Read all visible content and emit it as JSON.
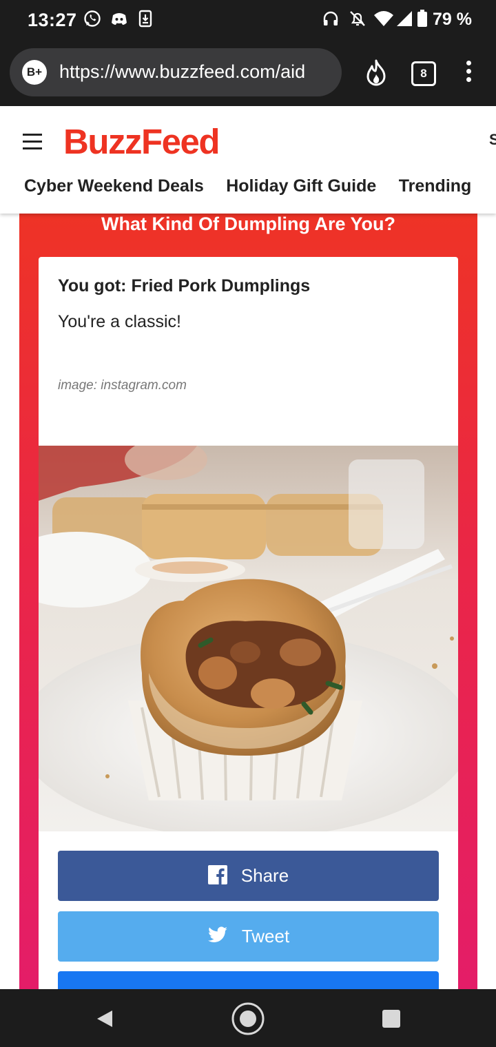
{
  "status_bar": {
    "time": "13:27",
    "battery": "79 %",
    "icons": [
      "whatsapp-icon",
      "discord-icon",
      "download-icon",
      "headphones-icon",
      "bell-off-icon",
      "wifi-icon",
      "signal-icon",
      "battery-icon"
    ]
  },
  "browser": {
    "site_badge": "B+",
    "url": "https://www.buzzfeed.com/aid",
    "tab_count": "8",
    "icons": [
      "fire-icon",
      "more-vert-icon"
    ]
  },
  "site": {
    "logo": "BuzzFeed",
    "header_cut": "S",
    "nav": [
      "Cyber Weekend Deals",
      "Holiday Gift Guide",
      "Trending"
    ]
  },
  "quiz": {
    "title": "What Kind Of Dumpling Are You?",
    "result_heading": "You got: Fried Pork Dumplings",
    "result_description": "You're a classic!",
    "image_credit": "image: instagram.com"
  },
  "share": {
    "facebook_label": "Share",
    "twitter_label": "Tweet",
    "third_label": ""
  },
  "colors": {
    "brand_red": "#ee3322",
    "facebook": "#3b5998",
    "twitter": "#55acee"
  }
}
